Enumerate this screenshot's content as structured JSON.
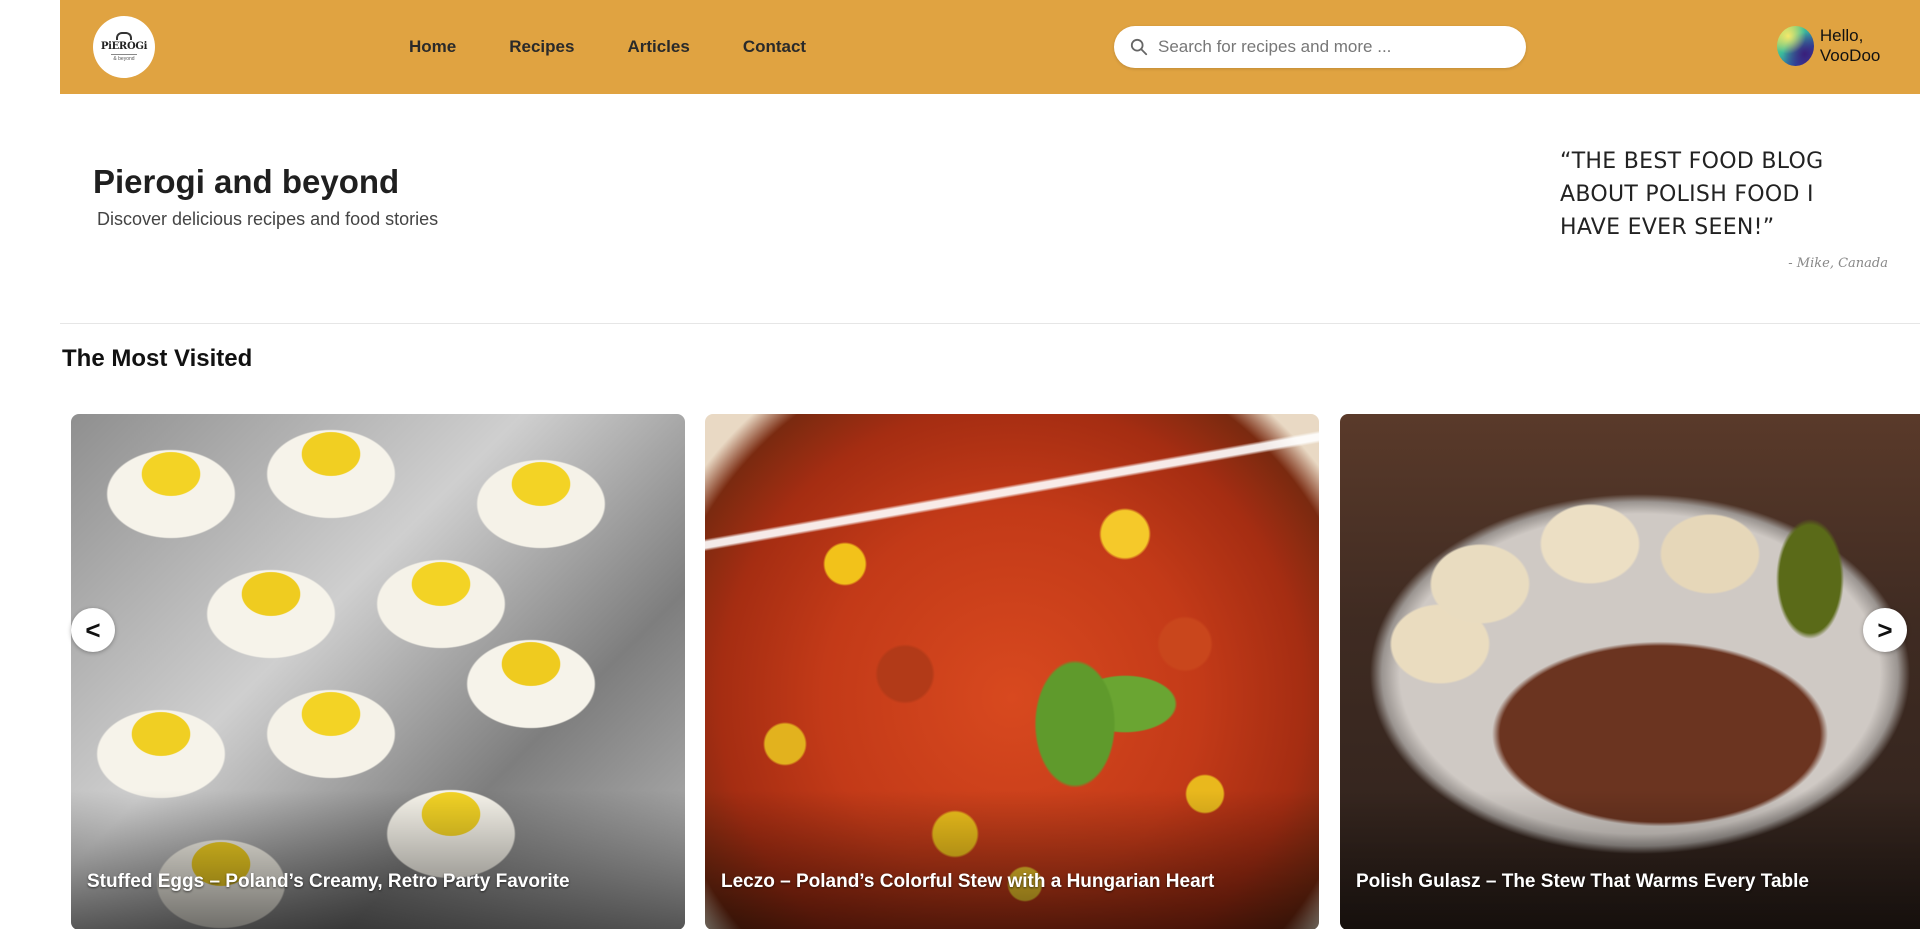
{
  "header": {
    "logo": {
      "name": "PiEROGi",
      "sub": "& beyond"
    },
    "nav": [
      {
        "label": "Home"
      },
      {
        "label": "Recipes"
      },
      {
        "label": "Articles"
      },
      {
        "label": "Contact"
      }
    ],
    "search": {
      "placeholder": "Search for recipes and more ...",
      "value": ""
    },
    "user": {
      "greeting": "Hello, VooDoo"
    },
    "colors": {
      "header_bg": "#E0A341"
    }
  },
  "hero": {
    "title": "Pierogi and beyond",
    "subtitle": "Discover delicious recipes and food stories",
    "quote": "“THE BEST FOOD BLOG ABOUT POLISH FOOD I HAVE EVER SEEN!”",
    "quote_author": "- Mike, Canada"
  },
  "most_visited": {
    "title": "The Most Visited",
    "cards": [
      {
        "title": "Stuffed Eggs – Poland’s Creamy, Retro Party Favorite"
      },
      {
        "title": "Leczo – Poland’s Colorful Stew with a Hungarian Heart"
      },
      {
        "title": "Polish Gulasz – The Stew That Warms Every Table"
      }
    ],
    "prev_label": "<",
    "next_label": ">"
  }
}
